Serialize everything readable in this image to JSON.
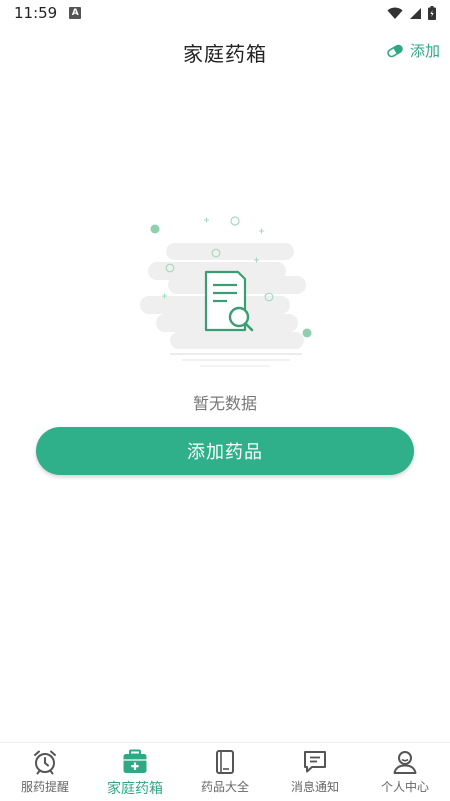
{
  "status_bar": {
    "time": "11:59",
    "notification_badge": "A",
    "icons": [
      "wifi-icon",
      "signal-icon",
      "battery-icon"
    ]
  },
  "header": {
    "title": "家庭药箱",
    "add_label": "添加",
    "add_icon": "pill-icon"
  },
  "empty_state": {
    "message": "暂无数据",
    "illustration": "document-search-icon"
  },
  "primary_action": {
    "label": "添加药品"
  },
  "tabs": [
    {
      "label": "服药提醒",
      "icon": "alarm-clock-icon",
      "active": false
    },
    {
      "label": "家庭药箱",
      "icon": "medicine-box-icon",
      "active": true
    },
    {
      "label": "药品大全",
      "icon": "book-icon",
      "active": false
    },
    {
      "label": "消息通知",
      "icon": "message-icon",
      "active": false
    },
    {
      "label": "个人中心",
      "icon": "user-icon",
      "active": false
    }
  ],
  "colors": {
    "accent": "#2fb08a",
    "accent_text": "#2fa884",
    "inactive": "#666666"
  }
}
